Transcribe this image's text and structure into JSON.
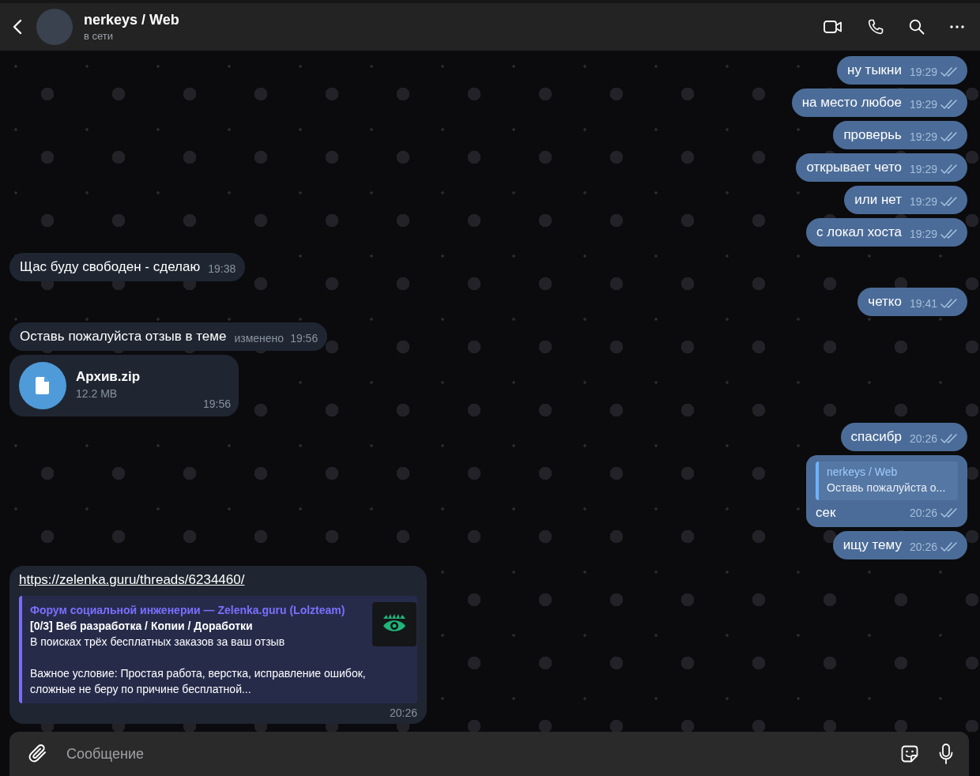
{
  "header": {
    "title": "nerkeys / Web",
    "status": "в сети"
  },
  "messages": [
    {
      "outgoing": true,
      "kind": "text",
      "text": "ну тыкни",
      "time": "19:29",
      "read": true
    },
    {
      "outgoing": true,
      "kind": "text",
      "text": "на место любое",
      "time": "19:29",
      "read": true
    },
    {
      "outgoing": true,
      "kind": "text",
      "text": "проверьь",
      "time": "19:29",
      "read": true
    },
    {
      "outgoing": true,
      "kind": "text",
      "text": "открывает чето",
      "time": "19:29",
      "read": true
    },
    {
      "outgoing": true,
      "kind": "text",
      "text": "или нет",
      "time": "19:29",
      "read": true
    },
    {
      "outgoing": true,
      "kind": "text",
      "text": "с локал хоста",
      "time": "19:29",
      "read": true
    },
    {
      "outgoing": false,
      "kind": "text",
      "text": "Щас буду свободен - сделаю",
      "time": "19:38"
    },
    {
      "outgoing": true,
      "kind": "text",
      "text": "четко",
      "time": "19:41",
      "read": true
    },
    {
      "outgoing": false,
      "kind": "text",
      "text": "Оставь пожалуйста отзыв в теме",
      "edited": "изменено",
      "time": "19:56"
    },
    {
      "outgoing": false,
      "kind": "file",
      "file_name": "Архив.zip",
      "file_size": "12.2 MB",
      "time": "19:56"
    },
    {
      "outgoing": true,
      "kind": "text",
      "text": "спасибр",
      "time": "20:26",
      "read": true
    },
    {
      "outgoing": true,
      "kind": "reply",
      "reply_author": "nerkeys / Web",
      "reply_text": "Оставь пожалуйста о...",
      "text": "сек",
      "time": "20:26",
      "read": true
    },
    {
      "outgoing": true,
      "kind": "text",
      "text": "ищу тему",
      "time": "20:26",
      "read": true
    },
    {
      "outgoing": false,
      "kind": "link",
      "url": "https://zelenka.guru/threads/6234460/",
      "preview": {
        "site": "Форум социальной инженерии —  Zelenka.guru (Lolzteam)",
        "title": "[0/3] Веб разработка / Копии / Доработки",
        "description": [
          [
            "В поисках трёх бесплатных заказов за ваш отзыв"
          ],
          [
            "Важное условие:  Простая работа, верстка, исправление ошибок,",
            "сложные не беру по причине бесплатной..."
          ]
        ]
      },
      "time": "20:26"
    }
  ],
  "composer": {
    "placeholder": "Сообщение"
  }
}
